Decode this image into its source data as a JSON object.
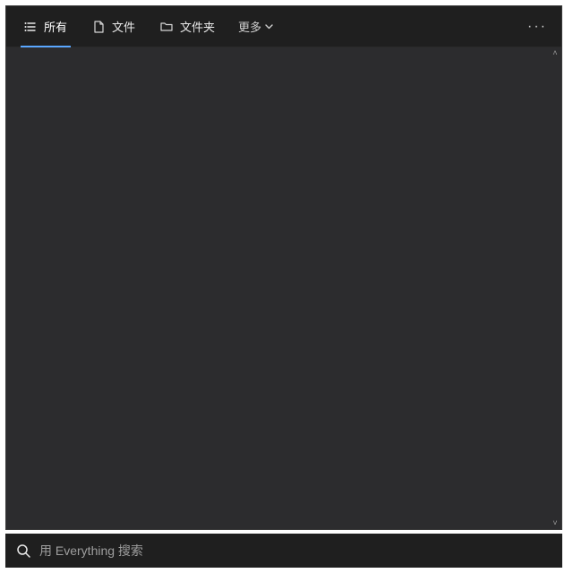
{
  "tabs": {
    "all": {
      "label": "所有",
      "icon": "list-icon"
    },
    "file": {
      "label": "文件",
      "icon": "file-icon"
    },
    "folder": {
      "label": "文件夹",
      "icon": "folder-icon"
    }
  },
  "more": {
    "label": "更多"
  },
  "overflow": {
    "glyph": "···"
  },
  "search": {
    "placeholder": "用 Everything 搜索"
  },
  "scroll": {
    "up": "˄",
    "down": "˅"
  }
}
